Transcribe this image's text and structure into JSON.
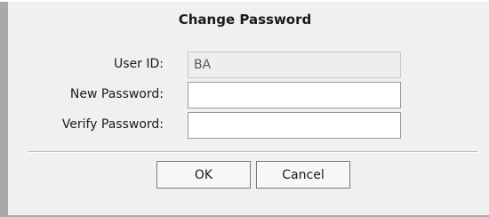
{
  "dialog": {
    "title": "Change Password",
    "fields": {
      "user_id": {
        "label": "User ID:",
        "value": "BA"
      },
      "new_password": {
        "label": "New Password:",
        "value": ""
      },
      "verify_password": {
        "label": "Verify Password:",
        "value": ""
      }
    },
    "buttons": {
      "ok_label": "OK",
      "cancel_label": "Cancel"
    }
  }
}
